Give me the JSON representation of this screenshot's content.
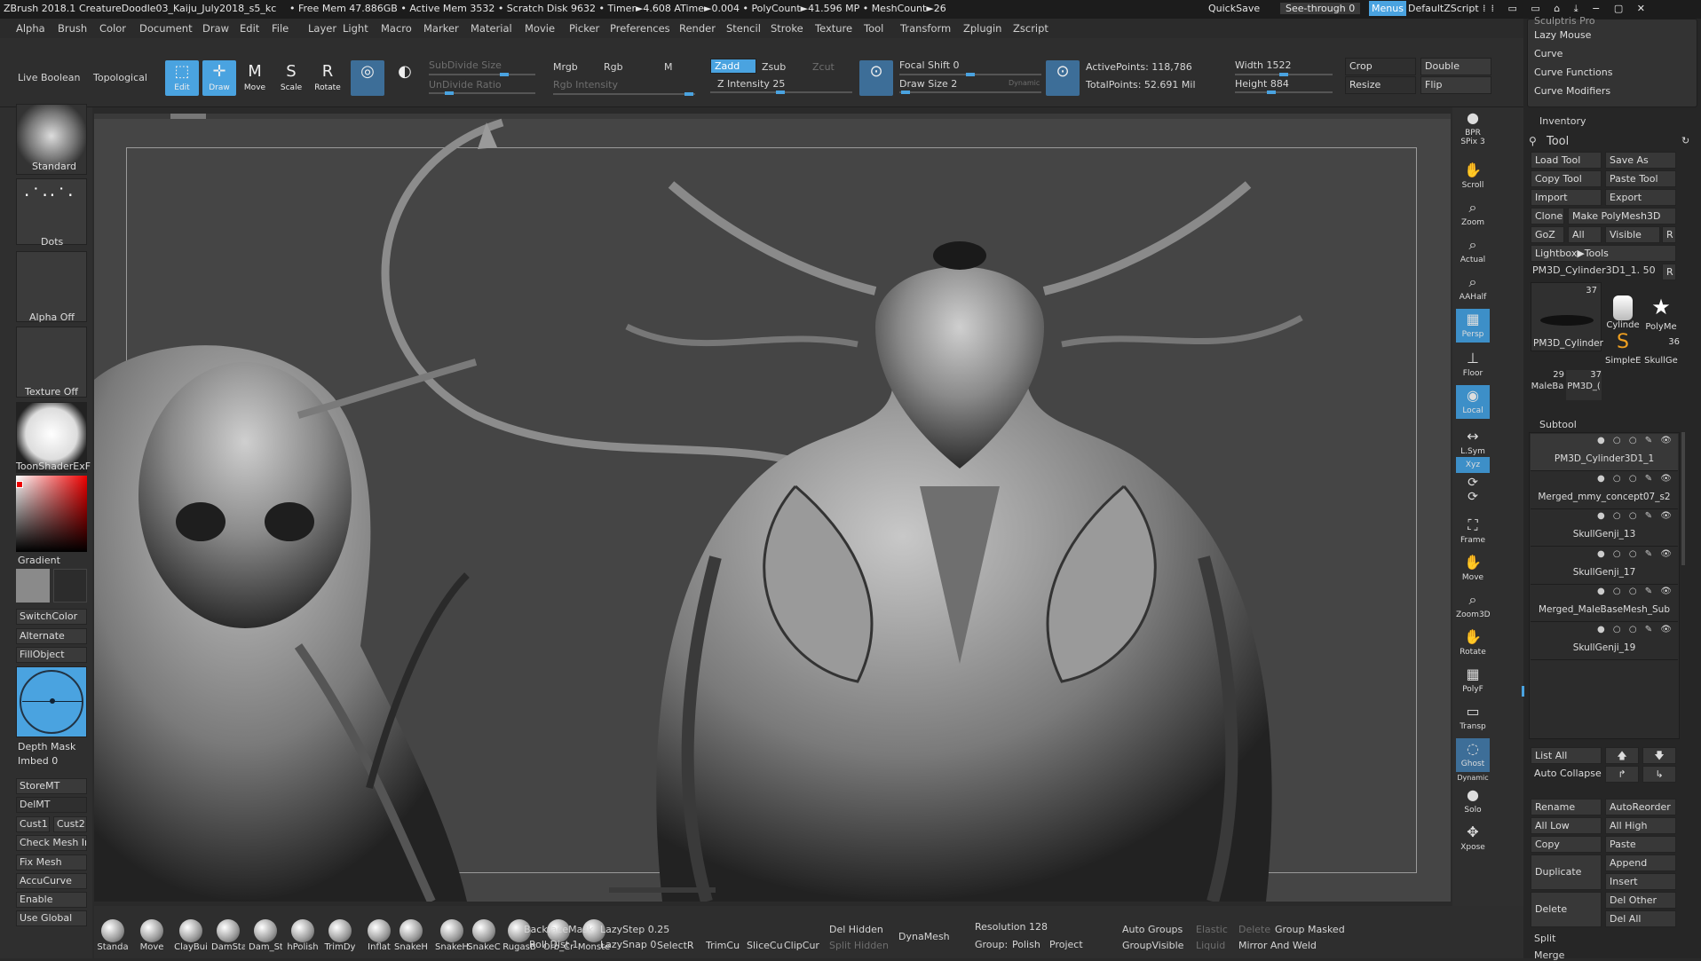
{
  "titlebar": {
    "app": "ZBrush 2018.1",
    "doc": "CreatureDoodle03_Kaiju_July2018_s5_kc",
    "freemem": "• Free Mem 47.886GB • Active Mem 3532 • Scratch Disk 9632 • Timer►4.608 ATime►0.004 • PolyCount►41.596 MP • MeshCount►26",
    "quicksave": "QuickSave",
    "seethrough": "See-through 0",
    "menus": "Menus",
    "script": "DefaultZScript"
  },
  "menubar": [
    "Alpha",
    "Brush",
    "Color",
    "Document",
    "Draw",
    "Edit",
    "File",
    "Layer",
    "Light",
    "Macro",
    "Marker",
    "Material",
    "Movie",
    "Picker",
    "Preferences",
    "Render",
    "Stencil",
    "Stroke",
    "Texture",
    "Tool",
    "Transform",
    "Zplugin",
    "Zscript"
  ],
  "shelf": {
    "live_boolean": "Live Boolean",
    "topological": "Topological",
    "edit": "Edit",
    "draw": "Draw",
    "move": "Move",
    "scale": "Scale",
    "rotate": "Rotate",
    "subdivide_size": "SubDivide Size",
    "undivide_ratio": "UnDivide Ratio",
    "mrgb": "Mrgb",
    "rgb": "Rgb",
    "m": "M",
    "rgb_intensity": "Rgb Intensity",
    "zadd": "Zadd",
    "zsub": "Zsub",
    "zcut": "Zcut",
    "z_intensity": "Z Intensity 25",
    "focal_shift": "Focal Shift 0",
    "draw_size": "Draw Size 2",
    "dynamic": "Dynamic",
    "active_points": "ActivePoints: 118,786",
    "total_points": "TotalPoints: 52.691 Mil",
    "width": "Width 1522",
    "height": "Height 884",
    "crop": "Crop",
    "resize": "Resize",
    "double": "Double",
    "flip": "Flip"
  },
  "left": {
    "standard": "Standard",
    "dots": "Dots",
    "alpha_off": "Alpha Off",
    "texture_off": "Texture Off",
    "material": "ToonShaderExF",
    "gradient": "Gradient",
    "switchcolor": "SwitchColor",
    "alternate": "Alternate",
    "fillobject": "FillObject",
    "depth_mask": "Depth Mask",
    "imbed": "Imbed 0",
    "storemt": "StoreMT",
    "delmt": "DelMT",
    "cust1": "Cust1",
    "cust2": "Cust2",
    "check_mesh": "Check Mesh In",
    "fix_mesh": "Fix Mesh",
    "accucurve": "AccuCurve",
    "enable": "Enable",
    "use_global": "Use Global"
  },
  "rightstrip": [
    "BPR",
    "SPix 3",
    "Scroll",
    "Zoom",
    "Actual",
    "AAHalf",
    "Persp",
    "Floor",
    "Local",
    "L.Sym",
    "Xyz",
    "Frame",
    "Move",
    "Zoom3D",
    "Rotate",
    "PolyF",
    "Transp",
    "Ghost",
    "Solo",
    "Xpose",
    "Dynamic"
  ],
  "bottom": {
    "brushes": [
      "Standa",
      "Move",
      "ClayBui",
      "DamSta",
      "Dam_St",
      "hPolish",
      "TrimDy",
      "Inflat",
      "SnakeH",
      "SnakeH",
      "SnakeC",
      "RugasB",
      "Orb_Cr",
      "Monste"
    ],
    "backfacemask": "BackfaceMask",
    "roll_dist": "Roll Dist 1",
    "lazystep": "LazyStep 0.25",
    "lazysnap": "LazySnap 0",
    "selectr": "SelectR",
    "trimcu": "TrimCu",
    "slicecu": "SliceCu",
    "clipcur": "ClipCur",
    "del_hidden": "Del Hidden",
    "split_hidden": "Split Hidden",
    "dynamesh": "DynaMesh",
    "resolution": "Resolution 128",
    "group": "Group:",
    "polish": "Polish",
    "project": "Project",
    "auto_groups": "Auto Groups",
    "elastic": "Elastic",
    "delete": "Delete",
    "group_masked": "Group Masked",
    "groupvisible": "GroupVisible",
    "liquid": "Liquid",
    "mirror_weld": "Mirror And Weld"
  },
  "rpanel": {
    "top_items": [
      "Sculptris Pro",
      "Lazy Mouse",
      "Curve",
      "Curve Functions",
      "Curve Modifiers"
    ],
    "inventory": "Inventory",
    "tool": "Tool",
    "load_tool": "Load Tool",
    "save_as": "Save As",
    "copy_tool": "Copy Tool",
    "paste_tool": "Paste Tool",
    "import": "Import",
    "export": "Export",
    "clone": "Clone",
    "make_polymesh": "Make PolyMesh3D",
    "goz": "GoZ",
    "all": "All",
    "visible": "Visible",
    "r": "R",
    "lightbox_tools": "Lightbox▶Tools",
    "current_tool": "PM3D_Cylinder3D1_1. 50",
    "thumbs": [
      {
        "label": "PM3D_Cylinder",
        "count": "37"
      },
      {
        "label": "Cylinde",
        "count": ""
      },
      {
        "label": "PolyMe",
        "count": ""
      },
      {
        "label": "SimpleE",
        "count": ""
      },
      {
        "label": "SkullGe",
        "count": "36"
      },
      {
        "label": "MaleBa",
        "count": "29"
      },
      {
        "label": "PM3D_(",
        "count": "37"
      }
    ],
    "subtool": "Subtool",
    "subtools": [
      "PM3D_Cylinder3D1_1",
      "Merged_mmy_concept07_s2",
      "SkullGenji_13",
      "SkullGenji_17",
      "Merged_MaleBaseMesh_Sub",
      "SkullGenji_19"
    ],
    "list_all": "List All",
    "auto_collapse": "Auto Collapse",
    "rename": "Rename",
    "autoreorder": "AutoReorder",
    "all_low": "All Low",
    "all_high": "All High",
    "copy": "Copy",
    "paste": "Paste",
    "duplicate": "Duplicate",
    "append": "Append",
    "insert": "Insert",
    "delete": "Delete",
    "del_other": "Del Other",
    "del_all": "Del All",
    "split": "Split",
    "merge": "Merge"
  },
  "colors": {
    "accent": "#4aa3e0",
    "bg": "#2a2a2a",
    "canvas": "#454545"
  }
}
